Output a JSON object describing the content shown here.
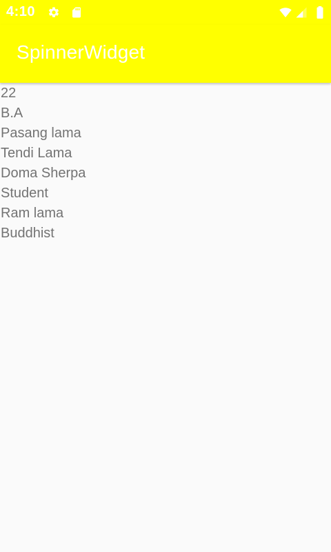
{
  "status_bar": {
    "time": "4:10",
    "left_icons": [
      "gear-icon",
      "sd-card-icon"
    ],
    "right_icons": [
      "wifi-icon",
      "cell-signal-icon",
      "battery-icon"
    ]
  },
  "app_bar": {
    "title": "SpinnerWidget",
    "color": "#ffff00"
  },
  "list": {
    "items": [
      "22",
      "B.A",
      "Pasang lama",
      "Tendi Lama",
      "Doma Sherpa",
      "Student",
      "Ram lama",
      "Buddhist"
    ]
  }
}
